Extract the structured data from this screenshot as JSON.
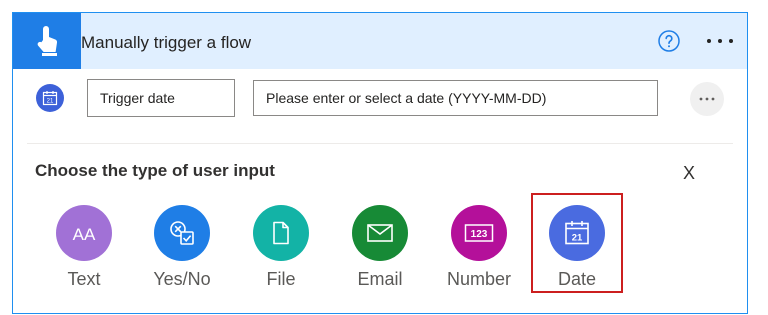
{
  "header": {
    "title": "Manually trigger a flow",
    "icon": "touch-trigger-icon",
    "help_icon": "help-icon",
    "more_icon": "more-options-icon",
    "accent": "#1f7ee6",
    "background": "#e0efff"
  },
  "input_row": {
    "icon": "calendar-icon",
    "name_value": "Trigger date",
    "date_placeholder": "Please enter or select a date (YYYY-MM-DD)",
    "menu_icon": "ellipsis-icon"
  },
  "chooser": {
    "title": "Choose the type of user input",
    "close_label": "X",
    "selected": "Date",
    "highlight_color": "#cc1f1f",
    "options": [
      {
        "label": "Text",
        "icon": "text-icon",
        "color": "#a171d6"
      },
      {
        "label": "Yes/No",
        "icon": "yes-no-icon",
        "color": "#1f7ee6"
      },
      {
        "label": "File",
        "icon": "file-icon",
        "color": "#13b3a6"
      },
      {
        "label": "Email",
        "icon": "email-icon",
        "color": "#178a36"
      },
      {
        "label": "Number",
        "icon": "number-icon",
        "color": "#b4109a"
      },
      {
        "label": "Date",
        "icon": "calendar-icon",
        "color": "#4a6be0",
        "glyph": "21"
      }
    ]
  },
  "text_glyph": "AA",
  "number_glyph": "123"
}
